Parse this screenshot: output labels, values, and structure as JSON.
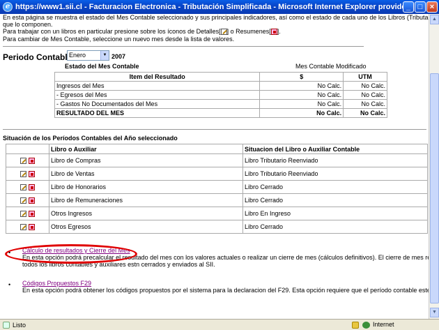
{
  "window": {
    "title": "https://www1.sii.cl - Facturacion Electronica - Tributación Simplificada - Microsoft Internet Explorer provided by SII",
    "min_glyph": "_",
    "max_glyph": "□",
    "close_glyph": "×"
  },
  "intro": {
    "line1": "En esta página se muestra el estado del Mes Contable seleccionado y sus principales indicadores, así como el estado de cada uno de los Libros (Tributarios o N",
    "line2": "que lo componen.",
    "line3_pre": "Para trabajar con un libros en particular presione sobre los íconos de Detalles[",
    "line3_mid": "] o Resumenes[",
    "line3_post": "].",
    "line4": "Para cambiar de Mes Contable, seleccione un nuevo mes desde la lista de valores."
  },
  "periodo": {
    "label": "Periodo Contable",
    "selected_month": "Enero",
    "year": "2007"
  },
  "estado": {
    "title": "Estado del Mes Contable",
    "status": "Mes Contable Modificado",
    "headers": [
      "Item del Resultado",
      "$",
      "UTM"
    ],
    "rows": [
      [
        "Ingresos del Mes",
        "No Calc.",
        "No Calc."
      ],
      [
        "- Egresos del Mes",
        "No Calc.",
        "No Calc."
      ],
      [
        "- Gastos No Documentados del Mes",
        "No Calc.",
        "No Calc."
      ],
      [
        "RESULTADO DEL MES",
        "No Calc.",
        "No Calc."
      ]
    ]
  },
  "situacion": {
    "title": "Situación de los Períodos Contables del Año seleccionado",
    "headers": [
      "",
      "Libro o Auxiliar",
      "Situacion del Libro o Auxiliar Contable"
    ],
    "rows": [
      [
        "Libro de Compras",
        "Libro Tributario Reenviado"
      ],
      [
        "Libro de Ventas",
        "Libro Tributario Reenviado"
      ],
      [
        "Libro de Honorarios",
        "Libro Cerrado"
      ],
      [
        "Libro de Remuneraciones",
        "Libro Cerrado"
      ],
      [
        "Otros Ingresos",
        "Libro En Ingreso"
      ],
      [
        "Otros Egresos",
        "Libro Cerrado"
      ]
    ]
  },
  "options": [
    {
      "link": "Cálculo de resultados y Cierre del Mes",
      "desc1": "En esta opción podrá precalcular el resultado del mes con los valores actuales o realizar un cierre de mes (cálculos definitivos). El cierre de mes requiere q",
      "desc2": "todos los libros contables y auxiliares estn cerrados y enviados al SII."
    },
    {
      "link": "Códigos Propuestos F29",
      "desc1": "En esta opción podrá obtener los códigos propuestos por el sistema para la declaracion del F29. Esta opción requiere que el período contable esté cerrado."
    }
  ],
  "statusbar": {
    "left": "Listo",
    "zone": "Internet"
  }
}
